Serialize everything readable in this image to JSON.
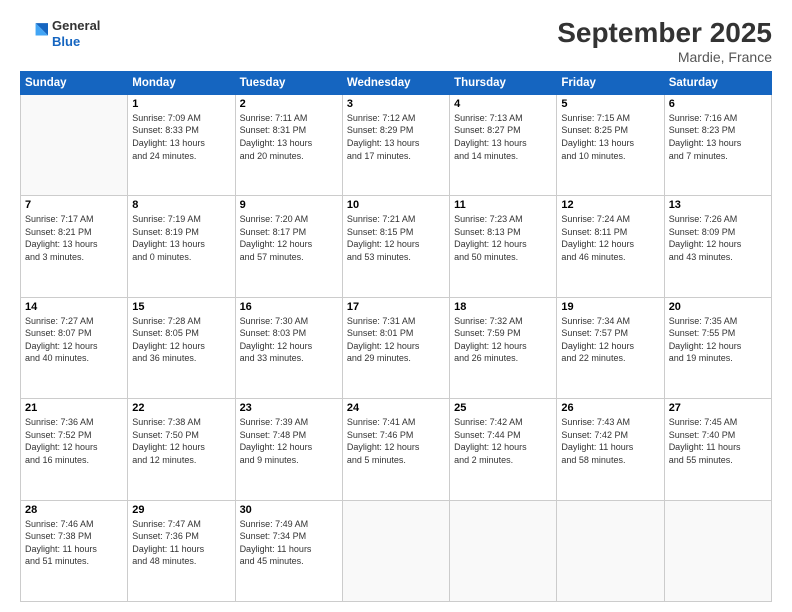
{
  "logo": {
    "line1": "General",
    "line2": "Blue"
  },
  "title": "September 2025",
  "subtitle": "Mardie, France",
  "header": {
    "colors": {
      "bg": "#1565c0"
    }
  },
  "weekdays": [
    "Sunday",
    "Monday",
    "Tuesday",
    "Wednesday",
    "Thursday",
    "Friday",
    "Saturday"
  ],
  "weeks": [
    [
      {
        "day": "",
        "info": ""
      },
      {
        "day": "1",
        "info": "Sunrise: 7:09 AM\nSunset: 8:33 PM\nDaylight: 13 hours\nand 24 minutes."
      },
      {
        "day": "2",
        "info": "Sunrise: 7:11 AM\nSunset: 8:31 PM\nDaylight: 13 hours\nand 20 minutes."
      },
      {
        "day": "3",
        "info": "Sunrise: 7:12 AM\nSunset: 8:29 PM\nDaylight: 13 hours\nand 17 minutes."
      },
      {
        "day": "4",
        "info": "Sunrise: 7:13 AM\nSunset: 8:27 PM\nDaylight: 13 hours\nand 14 minutes."
      },
      {
        "day": "5",
        "info": "Sunrise: 7:15 AM\nSunset: 8:25 PM\nDaylight: 13 hours\nand 10 minutes."
      },
      {
        "day": "6",
        "info": "Sunrise: 7:16 AM\nSunset: 8:23 PM\nDaylight: 13 hours\nand 7 minutes."
      }
    ],
    [
      {
        "day": "7",
        "info": "Sunrise: 7:17 AM\nSunset: 8:21 PM\nDaylight: 13 hours\nand 3 minutes."
      },
      {
        "day": "8",
        "info": "Sunrise: 7:19 AM\nSunset: 8:19 PM\nDaylight: 13 hours\nand 0 minutes."
      },
      {
        "day": "9",
        "info": "Sunrise: 7:20 AM\nSunset: 8:17 PM\nDaylight: 12 hours\nand 57 minutes."
      },
      {
        "day": "10",
        "info": "Sunrise: 7:21 AM\nSunset: 8:15 PM\nDaylight: 12 hours\nand 53 minutes."
      },
      {
        "day": "11",
        "info": "Sunrise: 7:23 AM\nSunset: 8:13 PM\nDaylight: 12 hours\nand 50 minutes."
      },
      {
        "day": "12",
        "info": "Sunrise: 7:24 AM\nSunset: 8:11 PM\nDaylight: 12 hours\nand 46 minutes."
      },
      {
        "day": "13",
        "info": "Sunrise: 7:26 AM\nSunset: 8:09 PM\nDaylight: 12 hours\nand 43 minutes."
      }
    ],
    [
      {
        "day": "14",
        "info": "Sunrise: 7:27 AM\nSunset: 8:07 PM\nDaylight: 12 hours\nand 40 minutes."
      },
      {
        "day": "15",
        "info": "Sunrise: 7:28 AM\nSunset: 8:05 PM\nDaylight: 12 hours\nand 36 minutes."
      },
      {
        "day": "16",
        "info": "Sunrise: 7:30 AM\nSunset: 8:03 PM\nDaylight: 12 hours\nand 33 minutes."
      },
      {
        "day": "17",
        "info": "Sunrise: 7:31 AM\nSunset: 8:01 PM\nDaylight: 12 hours\nand 29 minutes."
      },
      {
        "day": "18",
        "info": "Sunrise: 7:32 AM\nSunset: 7:59 PM\nDaylight: 12 hours\nand 26 minutes."
      },
      {
        "day": "19",
        "info": "Sunrise: 7:34 AM\nSunset: 7:57 PM\nDaylight: 12 hours\nand 22 minutes."
      },
      {
        "day": "20",
        "info": "Sunrise: 7:35 AM\nSunset: 7:55 PM\nDaylight: 12 hours\nand 19 minutes."
      }
    ],
    [
      {
        "day": "21",
        "info": "Sunrise: 7:36 AM\nSunset: 7:52 PM\nDaylight: 12 hours\nand 16 minutes."
      },
      {
        "day": "22",
        "info": "Sunrise: 7:38 AM\nSunset: 7:50 PM\nDaylight: 12 hours\nand 12 minutes."
      },
      {
        "day": "23",
        "info": "Sunrise: 7:39 AM\nSunset: 7:48 PM\nDaylight: 12 hours\nand 9 minutes."
      },
      {
        "day": "24",
        "info": "Sunrise: 7:41 AM\nSunset: 7:46 PM\nDaylight: 12 hours\nand 5 minutes."
      },
      {
        "day": "25",
        "info": "Sunrise: 7:42 AM\nSunset: 7:44 PM\nDaylight: 12 hours\nand 2 minutes."
      },
      {
        "day": "26",
        "info": "Sunrise: 7:43 AM\nSunset: 7:42 PM\nDaylight: 11 hours\nand 58 minutes."
      },
      {
        "day": "27",
        "info": "Sunrise: 7:45 AM\nSunset: 7:40 PM\nDaylight: 11 hours\nand 55 minutes."
      }
    ],
    [
      {
        "day": "28",
        "info": "Sunrise: 7:46 AM\nSunset: 7:38 PM\nDaylight: 11 hours\nand 51 minutes."
      },
      {
        "day": "29",
        "info": "Sunrise: 7:47 AM\nSunset: 7:36 PM\nDaylight: 11 hours\nand 48 minutes."
      },
      {
        "day": "30",
        "info": "Sunrise: 7:49 AM\nSunset: 7:34 PM\nDaylight: 11 hours\nand 45 minutes."
      },
      {
        "day": "",
        "info": ""
      },
      {
        "day": "",
        "info": ""
      },
      {
        "day": "",
        "info": ""
      },
      {
        "day": "",
        "info": ""
      }
    ]
  ]
}
